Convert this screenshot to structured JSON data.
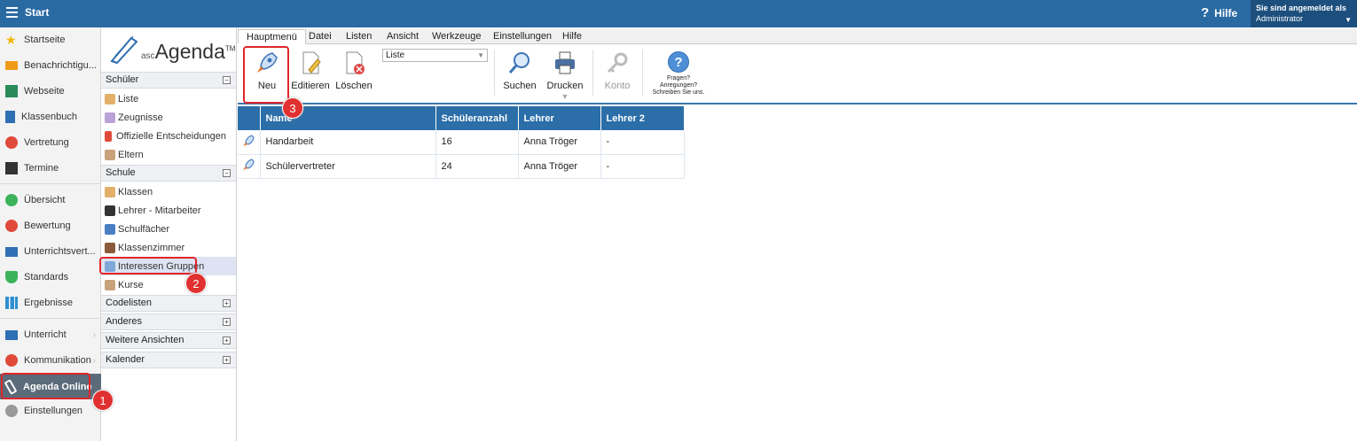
{
  "topbar": {
    "title": "Start",
    "help": "Hilfe",
    "user_line1": "Sie sind angemeldet als",
    "user_line2": "Administrator"
  },
  "leftnav": {
    "items": [
      {
        "label": "Startseite",
        "color": "#f0b800"
      },
      {
        "label": "Benachrichtigu...",
        "color": "#f09a1a"
      },
      {
        "label": "Webseite",
        "color": "#2a8a5a"
      },
      {
        "label": "Klassenbuch",
        "color": "#2f6fb3"
      },
      {
        "label": "Vertretung",
        "color": "#e04a3a"
      },
      {
        "label": "Termine",
        "color": "#333333"
      },
      {
        "label": "Übersicht",
        "color": "#3cb35a"
      },
      {
        "label": "Bewertung",
        "color": "#e04a3a"
      },
      {
        "label": "Unterrichtsvert...",
        "color": "#2f6fb3"
      },
      {
        "label": "Standards",
        "color": "#3cb35a"
      },
      {
        "label": "Ergebnisse",
        "color": "#2f8fd0"
      },
      {
        "label": "Unterricht",
        "color": "#2f6fb3"
      },
      {
        "label": "Kommunikation",
        "color": "#e04a3a"
      },
      {
        "label": "Agenda Online",
        "color": "#ffffff"
      },
      {
        "label": "Einstellungen",
        "color": "#999999"
      }
    ]
  },
  "tree": {
    "logo_asc": "asc",
    "logo_main": "Agenda",
    "logo_tm": "TM",
    "sections": {
      "schueler": "Schüler",
      "schule": "Schule",
      "codelisten": "Codelisten",
      "anderes": "Anderes",
      "weitere": "Weitere Ansichten",
      "kalender": "Kalender"
    },
    "schueler_items": [
      "Liste",
      "Zeugnisse",
      "Offizielle Entscheidungen",
      "Eltern"
    ],
    "schule_items": [
      "Klassen",
      "Lehrer - Mitarbeiter",
      "Schulfächer",
      "Klassenzimmer",
      "Interessen Gruppen",
      "Kurse"
    ]
  },
  "tabs": [
    "Hauptmenü",
    "Datei",
    "Listen",
    "Ansicht",
    "Werkzeuge",
    "Einstellungen",
    "Hilfe"
  ],
  "ribbon": {
    "neu": "Neu",
    "editieren": "Editieren",
    "loeschen": "Löschen",
    "select_value": "Liste",
    "suchen": "Suchen",
    "drucken": "Drucken",
    "konto": "Konto",
    "help_line1": "Fragen?",
    "help_line2": "Anregungen?",
    "help_line3": "Schreiben Sie uns."
  },
  "table": {
    "headers": [
      "Name",
      "Schüleranzahl",
      "Lehrer",
      "Lehrer 2"
    ],
    "rows": [
      [
        "Handarbeit",
        "16",
        "Anna Tröger",
        "-"
      ],
      [
        "Schülervertreter",
        "24",
        "Anna Tröger",
        "-"
      ]
    ]
  },
  "badges": [
    "1",
    "2",
    "3"
  ]
}
